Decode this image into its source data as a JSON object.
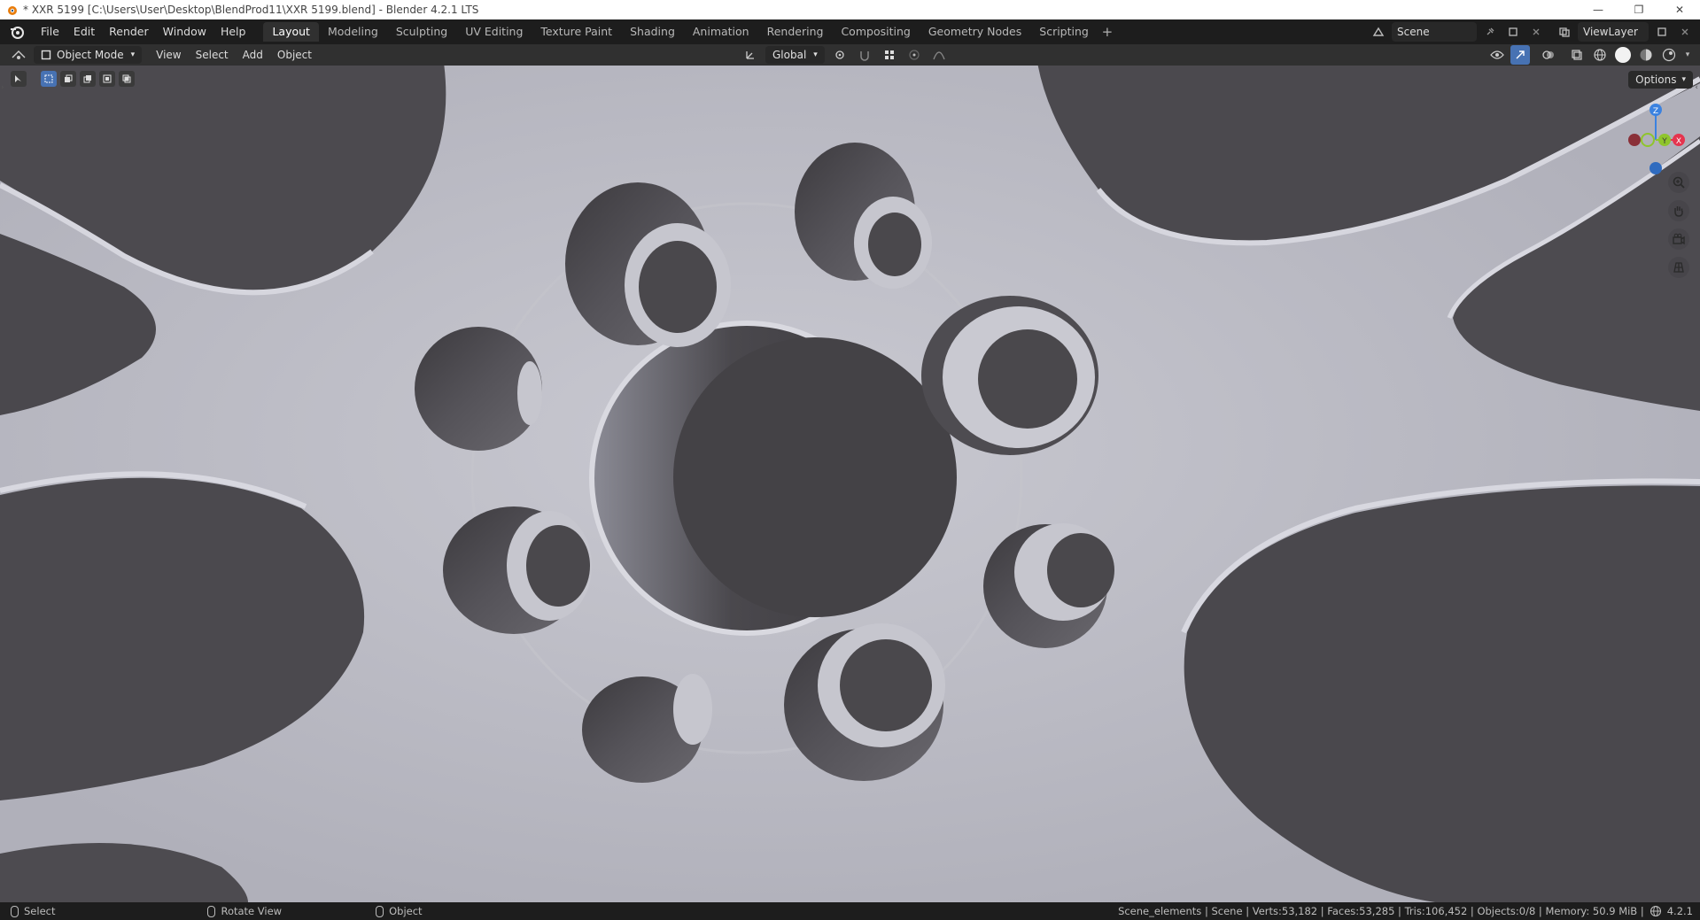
{
  "window": {
    "title": "* XXR 5199 [C:\\Users\\User\\Desktop\\BlendProd11\\XXR 5199.blend] - Blender 4.2.1 LTS",
    "minimize": "—",
    "maximize": "❐",
    "close": "✕"
  },
  "menu": {
    "items": [
      "File",
      "Edit",
      "Render",
      "Window",
      "Help"
    ]
  },
  "workspaces": {
    "tabs": [
      "Layout",
      "Modeling",
      "Sculpting",
      "UV Editing",
      "Texture Paint",
      "Shading",
      "Animation",
      "Rendering",
      "Compositing",
      "Geometry Nodes",
      "Scripting"
    ],
    "active": "Layout",
    "add": "+"
  },
  "scene": {
    "name": "Scene"
  },
  "view_layer": {
    "name": "ViewLayer"
  },
  "viewport_header": {
    "mode": "Object Mode",
    "menus": [
      "View",
      "Select",
      "Add",
      "Object"
    ],
    "transform_orientation": "Global"
  },
  "viewport": {
    "options_label": "Options",
    "gizmo_axes": {
      "z": "Z",
      "y": "Y",
      "x": "X"
    },
    "colors": {
      "x_axis": "#e5344e",
      "y_axis": "#8fc52c",
      "z_axis": "#3b82e0",
      "mesh": "#b8b8c2",
      "hole": "#4d4b50"
    }
  },
  "statusbar": {
    "left": [
      {
        "label": "Select"
      },
      {
        "label": "Rotate View"
      },
      {
        "label": "Object"
      }
    ],
    "stats": "Scene_elements | Scene | Verts:53,182 | Faces:53,285 | Tris:106,452 | Objects:0/8 | Memory: 50.9 MiB |",
    "version": "4.2.1"
  }
}
